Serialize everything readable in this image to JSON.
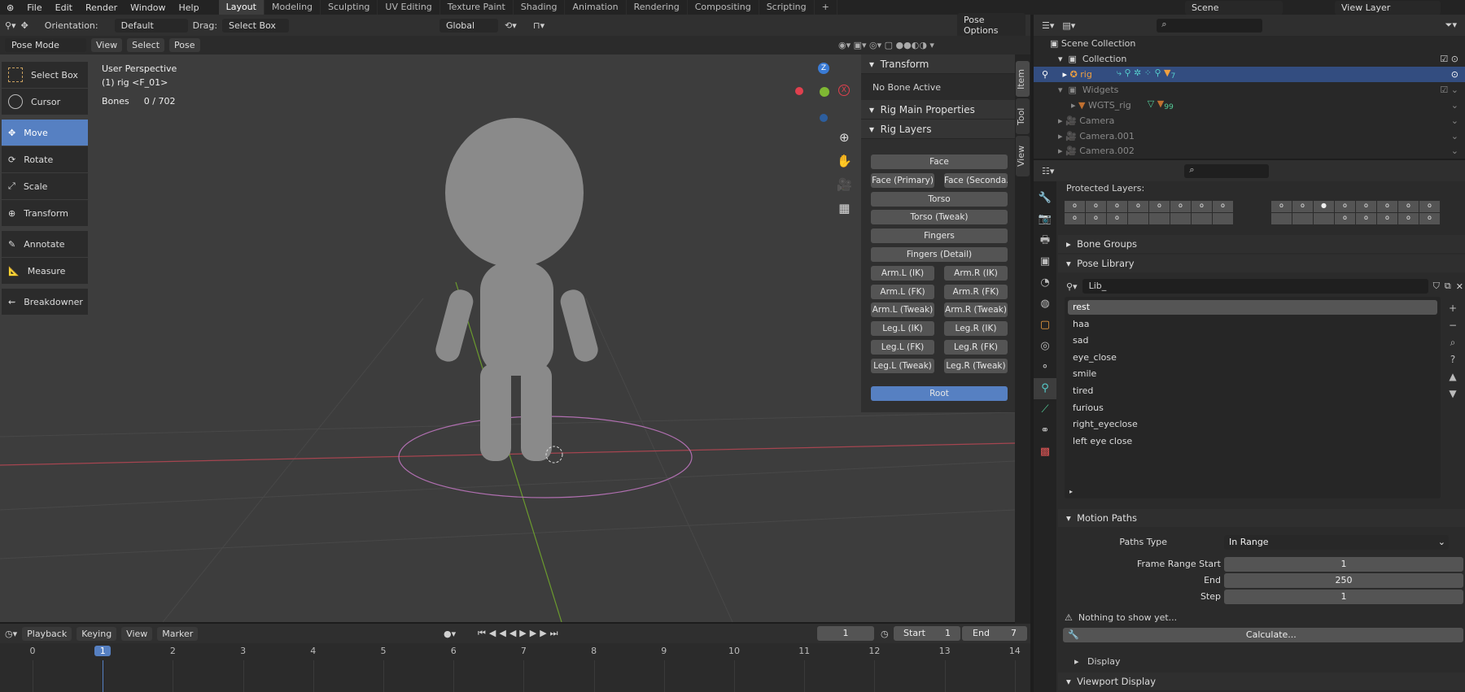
{
  "menu": [
    "File",
    "Edit",
    "Render",
    "Window",
    "Help"
  ],
  "workspaces": [
    "Layout",
    "Modeling",
    "Sculpting",
    "UV Editing",
    "Texture Paint",
    "Shading",
    "Animation",
    "Rendering",
    "Compositing",
    "Scripting",
    "+"
  ],
  "scene": "Scene",
  "view_layer": "View Layer",
  "header": {
    "orientation_label": "Orientation:",
    "orientation": "Default",
    "drag_label": "Drag:",
    "drag": "Select Box",
    "transform_space": "Global",
    "pose_options": "Pose Options"
  },
  "mode": {
    "mode": "Pose Mode",
    "view": "View",
    "select": "Select",
    "pose": "Pose"
  },
  "overlay": {
    "perspective": "User Perspective",
    "object": "(1) rig <F_01>",
    "bones_label": "Bones",
    "bones": "0 / 702"
  },
  "tools": [
    "Select Box",
    "Cursor",
    "Move",
    "Rotate",
    "Scale",
    "Transform",
    "Annotate",
    "Measure",
    "Breakdowner"
  ],
  "gizmo": {
    "z": "Z",
    "x": "X"
  },
  "npanel": {
    "transform": "Transform",
    "no_bone": "No Bone Active",
    "rig_main": "Rig Main Properties",
    "rig_layers": "Rig Layers",
    "layers": [
      "Face",
      "Face (Primary)",
      "Face (Seconda...",
      "Torso",
      "Torso (Tweak)",
      "Fingers",
      "Fingers (Detail)",
      "Arm.L (IK)",
      "Arm.R (IK)",
      "Arm.L (FK)",
      "Arm.R (FK)",
      "Arm.L (Tweak)",
      "Arm.R (Tweak)",
      "Leg.L (IK)",
      "Leg.R (IK)",
      "Leg.L (FK)",
      "Leg.R (FK)",
      "Leg.L (Tweak)",
      "Leg.R (Tweak)"
    ],
    "root": "Root",
    "tabs": [
      "Item",
      "Tool",
      "View"
    ]
  },
  "timeline": {
    "playback": "Playback",
    "keying": "Keying",
    "view": "View",
    "marker": "Marker",
    "frame": "1",
    "start_label": "Start",
    "start": "1",
    "end_label": "End",
    "end": "7",
    "ticks": [
      "0",
      "1",
      "2",
      "3",
      "4",
      "5",
      "6",
      "7",
      "8",
      "9",
      "10",
      "11",
      "12",
      "13",
      "14"
    ]
  },
  "outliner": {
    "root": "Scene Collection",
    "items": [
      {
        "name": "Collection"
      },
      {
        "name": "rig",
        "badge": "7"
      },
      {
        "name": "Widgets"
      },
      {
        "name": "WGTS_rig",
        "badge": "99"
      },
      {
        "name": "Camera"
      },
      {
        "name": "Camera.001"
      },
      {
        "name": "Camera.002"
      }
    ]
  },
  "properties": {
    "protected": "Protected Layers:",
    "bone_groups": "Bone Groups",
    "pose_library": "Pose Library",
    "lib_name": "Lib_",
    "poses": [
      "rest",
      "haa",
      "sad",
      "eye_close",
      "smile",
      "tired",
      "furious",
      "right_eyeclose",
      "left eye close"
    ],
    "motion_paths": "Motion Paths",
    "paths_type_label": "Paths Type",
    "paths_type": "In Range",
    "frs_label": "Frame Range Start",
    "frs": "1",
    "end_label": "End",
    "end": "250",
    "step_label": "Step",
    "step": "1",
    "nothing": "Nothing to show yet...",
    "calculate": "Calculate...",
    "display": "Display",
    "viewport_display": "Viewport Display"
  },
  "colors": {
    "accent": "#5680c2",
    "selected_row": "#334d80",
    "x_axis": "#e0404e",
    "y_axis": "#7fb833",
    "z_axis": "#3a7bd5"
  }
}
